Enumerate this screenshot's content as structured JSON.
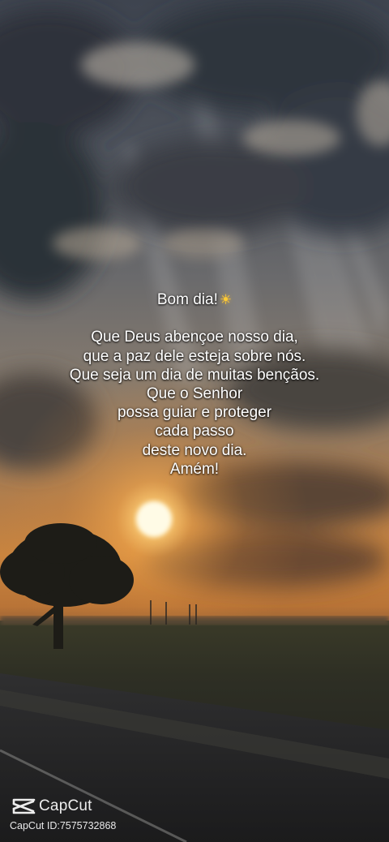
{
  "post": {
    "greeting": "Bom dia!",
    "greeting_emoji": "☀",
    "lines": [
      "Que Deus abençoe nosso dia,",
      "que a paz dele esteja sobre nós.",
      "Que seja um dia de muitas bençãos.",
      "Que o Senhor",
      "possa guiar e proteger",
      "cada passo",
      "deste novo dia.",
      "Amém!"
    ]
  },
  "watermark": {
    "brand": "CapCut",
    "id_text": "CapCut ID:7575732868"
  }
}
